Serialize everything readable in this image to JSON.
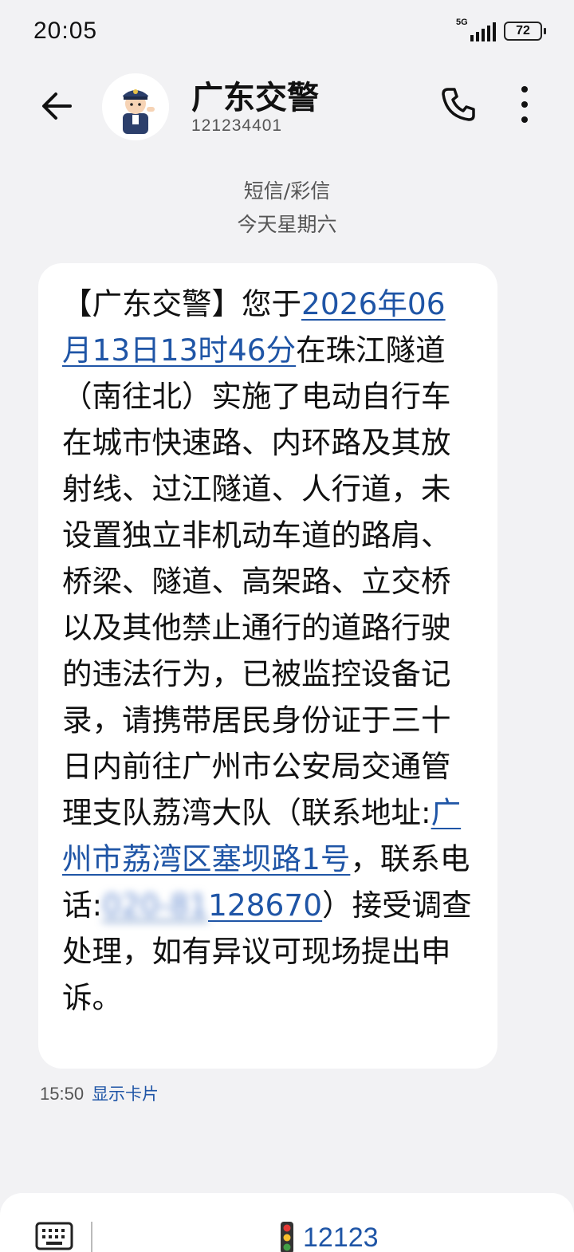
{
  "status": {
    "time": "20:05",
    "network": "5G",
    "battery": "72"
  },
  "header": {
    "contact_name": "广东交警",
    "contact_number": "121234401"
  },
  "thread": {
    "message_type": "短信/彩信",
    "date_label": "今天星期六"
  },
  "message": {
    "part1": "【广东交警】您于",
    "datetime_link": "2026年06月13日13时46分",
    "part2": "在珠江隧道（南往北）实施了电动自行车在城市快速路、内环路及其放射线、过江隧道、人行道，未设置独立非机动车道的路肩、桥梁、隧道、高架路、立交桥以及其他禁止通行的道路行驶的违法行为，已被监控设备记录，请携带居民身份证于三十日内前往广州市公安局交通管理支队荔湾大队（联系地址:",
    "address_link": "广州市荔湾区塞坝路1号",
    "part3": "，联系电话:",
    "phone_hidden": "020-81",
    "phone_visible": "128670",
    "part4": "）接受调查处理，如有异议可现场提出申诉。",
    "time": "15:50",
    "show_card_label": "显示卡片"
  },
  "bottom_bar": {
    "service_number": "12123"
  },
  "colors": {
    "link": "#1f55a6",
    "background": "#f2f2f4",
    "bubble": "#ffffff"
  }
}
